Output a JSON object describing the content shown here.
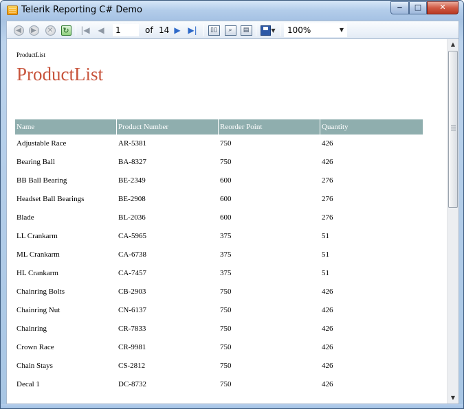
{
  "window": {
    "title": "Telerik Reporting C# Demo"
  },
  "toolbar": {
    "current_page": "1",
    "of_label": "of",
    "total_pages": "14",
    "zoom": "100%"
  },
  "report": {
    "small_title": "ProductList",
    "title": "ProductList",
    "columns": [
      "Name",
      "Product Number",
      "Reorder Point",
      "Quantity"
    ],
    "rows": [
      [
        "Adjustable Race",
        "AR-5381",
        "750",
        "426"
      ],
      [
        "Bearing Ball",
        "BA-8327",
        "750",
        "426"
      ],
      [
        "BB Ball Bearing",
        "BE-2349",
        "600",
        "276"
      ],
      [
        "Headset Ball Bearings",
        "BE-2908",
        "600",
        "276"
      ],
      [
        "Blade",
        "BL-2036",
        "600",
        "276"
      ],
      [
        "LL Crankarm",
        "CA-5965",
        "375",
        "51"
      ],
      [
        "ML Crankarm",
        "CA-6738",
        "375",
        "51"
      ],
      [
        "HL Crankarm",
        "CA-7457",
        "375",
        "51"
      ],
      [
        "Chainring Bolts",
        "CB-2903",
        "750",
        "426"
      ],
      [
        "Chainring Nut",
        "CN-6137",
        "750",
        "426"
      ],
      [
        "Chainring",
        "CR-7833",
        "750",
        "426"
      ],
      [
        "Crown Race",
        "CR-9981",
        "750",
        "426"
      ],
      [
        "Chain Stays",
        "CS-2812",
        "750",
        "426"
      ],
      [
        "Decal 1",
        "DC-8732",
        "750",
        "426"
      ]
    ]
  }
}
